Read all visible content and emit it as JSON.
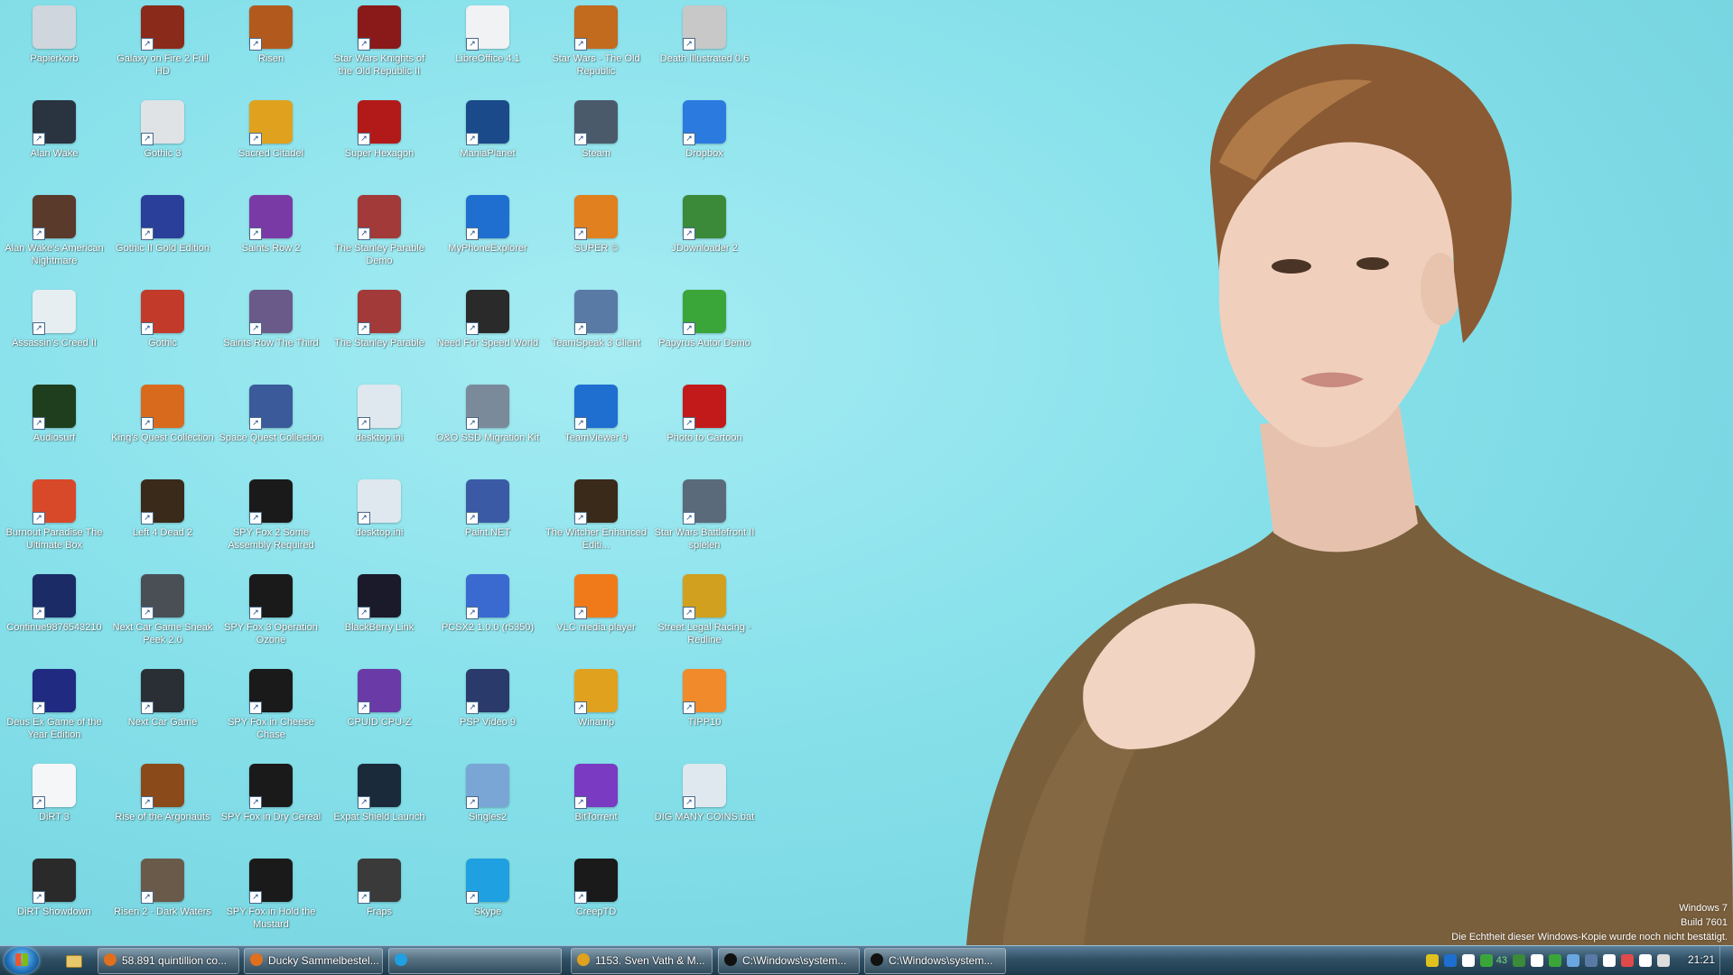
{
  "desktop": {
    "columns": [
      [
        {
          "label": "Papierkorb",
          "icon": "recycle-bin-icon",
          "color": "#cfd6dd"
        },
        {
          "label": "Alan Wake",
          "icon": "game-icon",
          "color": "#2a3340"
        },
        {
          "label": "Alan Wake's American Nightmare",
          "icon": "game-icon",
          "color": "#5a3a2a"
        },
        {
          "label": "Assassin's Creed II",
          "icon": "game-icon",
          "color": "#e6eef2"
        },
        {
          "label": "Audiosurf",
          "icon": "game-icon",
          "color": "#1e3e1e"
        },
        {
          "label": "Burnout Paradise The Ultimate Box",
          "icon": "game-icon",
          "color": "#d8492a"
        },
        {
          "label": "Continue9876543210",
          "icon": "game-icon",
          "color": "#1b2b66"
        },
        {
          "label": "Deus Ex Game of the Year Edition",
          "icon": "game-icon",
          "color": "#1f2a80"
        },
        {
          "label": "DiRT 3",
          "icon": "file-icon",
          "color": "#f4f6f8"
        },
        {
          "label": "DiRT Showdown",
          "icon": "game-icon",
          "color": "#2a2a2a"
        }
      ],
      [
        {
          "label": "Galaxy on Fire 2 Full HD",
          "icon": "game-icon",
          "color": "#8a2a1a"
        },
        {
          "label": "Gothic 3",
          "icon": "game-icon",
          "color": "#dfe3e6"
        },
        {
          "label": "Gothic II Gold Edition",
          "icon": "game-icon",
          "color": "#2a3f9a"
        },
        {
          "label": "Gothic",
          "icon": "game-icon",
          "color": "#c23a2a"
        },
        {
          "label": "King's Quest Collection",
          "icon": "game-icon",
          "color": "#d86a1e"
        },
        {
          "label": "Left 4 Dead 2",
          "icon": "game-icon",
          "color": "#3a2a1a"
        },
        {
          "label": "Next Car Game Sneak Peek 2.0",
          "icon": "game-icon",
          "color": "#4a4f56"
        },
        {
          "label": "Next Car Game",
          "icon": "game-icon",
          "color": "#2a2f36"
        },
        {
          "label": "Rise of the Argonauts",
          "icon": "game-icon",
          "color": "#8a4a1a"
        },
        {
          "label": "Risen 2 - Dark Waters",
          "icon": "game-icon",
          "color": "#6a5a4a"
        }
      ],
      [
        {
          "label": "Risen",
          "icon": "game-icon",
          "color": "#b25a1e"
        },
        {
          "label": "Sacred Citadel",
          "icon": "game-icon",
          "color": "#e0a21e"
        },
        {
          "label": "Saints Row 2",
          "icon": "game-icon",
          "color": "#7a3aa6"
        },
        {
          "label": "Saints Row The Third",
          "icon": "game-icon",
          "color": "#6a5a8a"
        },
        {
          "label": "Space Quest Collection",
          "icon": "game-icon",
          "color": "#3a5a9a"
        },
        {
          "label": "SPY Fox 2 Some Assembly Required",
          "icon": "game-icon",
          "color": "#1a1a1a"
        },
        {
          "label": "SPY Fox 3 Operation Ozone",
          "icon": "game-icon",
          "color": "#1a1a1a"
        },
        {
          "label": "SPY Fox in Cheese Chase",
          "icon": "game-icon",
          "color": "#1a1a1a"
        },
        {
          "label": "SPY Fox in Dry Cereal",
          "icon": "game-icon",
          "color": "#1a1a1a"
        },
        {
          "label": "SPY Fox in Hold the Mustard",
          "icon": "game-icon",
          "color": "#1a1a1a"
        }
      ],
      [
        {
          "label": "Star Wars Knights of the Old Republic II",
          "icon": "game-icon",
          "color": "#8a1a1a"
        },
        {
          "label": "Super Hexagon",
          "icon": "game-icon",
          "color": "#b21a1a"
        },
        {
          "label": "The Stanley Parable Demo",
          "icon": "game-icon",
          "color": "#a23a3a"
        },
        {
          "label": "The Stanley Parable",
          "icon": "game-icon",
          "color": "#a23a3a"
        },
        {
          "label": "desktop.ini",
          "icon": "settings-file-icon",
          "color": "#dfe8ee"
        },
        {
          "label": "desktop.ini",
          "icon": "settings-file-icon",
          "color": "#dfe8ee"
        },
        {
          "label": "BlackBerry Link",
          "icon": "blackberry-icon",
          "color": "#1a1a2a"
        },
        {
          "label": "CPUID CPU-Z",
          "icon": "cpu-icon",
          "color": "#6a3aa6"
        },
        {
          "label": "Expat Shield Launch",
          "icon": "shield-icon",
          "color": "#1a2a3a"
        },
        {
          "label": "Fraps",
          "icon": "fraps-icon",
          "color": "#3a3a3a"
        }
      ],
      [
        {
          "label": "LibreOffice 4.1",
          "icon": "file-icon",
          "color": "#f0f2f4"
        },
        {
          "label": "ManiaPlanet",
          "icon": "game-icon",
          "color": "#1a4a8a"
        },
        {
          "label": "MyPhoneExplorer",
          "icon": "sync-icon",
          "color": "#1f6fd0"
        },
        {
          "label": "Need For Speed World",
          "icon": "game-icon",
          "color": "#2a2a2a"
        },
        {
          "label": "O&O SSD Migration Kit",
          "icon": "tool-icon",
          "color": "#7a8a9a"
        },
        {
          "label": "Paint.NET",
          "icon": "paint-icon",
          "color": "#3a5aa6"
        },
        {
          "label": "PCSX2 1.0.0 (r5350)",
          "icon": "emulator-icon",
          "color": "#3a6ad0"
        },
        {
          "label": "PSP Video 9",
          "icon": "video-icon",
          "color": "#2a3a6a"
        },
        {
          "label": "Singles2",
          "icon": "game-icon",
          "color": "#7aa6d6"
        },
        {
          "label": "Skype",
          "icon": "skype-icon",
          "color": "#1fa0e0"
        }
      ],
      [
        {
          "label": "Star Wars - The Old Republic",
          "icon": "game-icon",
          "color": "#c26a1e"
        },
        {
          "label": "Steam",
          "icon": "steam-icon",
          "color": "#4a5a6a"
        },
        {
          "label": "SUPER ©",
          "icon": "media-converter-icon",
          "color": "#e0801e"
        },
        {
          "label": "TeamSpeak 3 Client",
          "icon": "teamspeak-icon",
          "color": "#5a7aa6"
        },
        {
          "label": "TeamViewer 9",
          "icon": "teamviewer-icon",
          "color": "#1e6fd0"
        },
        {
          "label": "The Witcher Enhanced Editi...",
          "icon": "game-icon",
          "color": "#3a2a1a"
        },
        {
          "label": "VLC media player",
          "icon": "vlc-icon",
          "color": "#f07a1a"
        },
        {
          "label": "Winamp",
          "icon": "winamp-icon",
          "color": "#e0a21e"
        },
        {
          "label": "BitTorrent",
          "icon": "bittorrent-icon",
          "color": "#7a3ac2"
        },
        {
          "label": "CreepTD",
          "icon": "game-icon",
          "color": "#1a1a1a"
        }
      ],
      [
        {
          "label": "Death Illustrated 0.6",
          "icon": "game-icon",
          "color": "#c8c8c8"
        },
        {
          "label": "Dropbox",
          "icon": "dropbox-icon",
          "color": "#2a7ae0"
        },
        {
          "label": "JDownloader 2",
          "icon": "download-icon",
          "color": "#3a8a3a"
        },
        {
          "label": "Papyrus Autor Demo",
          "icon": "papyrus-icon",
          "color": "#3aa63a"
        },
        {
          "label": "Photo to Cartoon",
          "icon": "pen-icon",
          "color": "#c21a1a"
        },
        {
          "label": "Star Wars Battlefront II spielen",
          "icon": "game-icon",
          "color": "#5a6a7a"
        },
        {
          "label": "Street Legal Racing - Redline",
          "icon": "game-icon",
          "color": "#d0a01e"
        },
        {
          "label": "TIPP10",
          "icon": "tipp10-icon",
          "color": "#f08a2a"
        },
        {
          "label": "DIG MANY COINS.bat",
          "icon": "batch-file-icon",
          "color": "#dfe8ee"
        },
        {
          "label": "",
          "icon": "",
          "color": ""
        }
      ]
    ]
  },
  "watermark": {
    "line1": "Windows 7",
    "line2": "Build 7601",
    "line3": "Die Echtheit dieser Windows-Kopie wurde noch nicht bestätigt."
  },
  "taskbar": {
    "items": [
      {
        "label": "58.891 quintillion co...",
        "icon": "firefox-icon",
        "color": "#e0701e"
      },
      {
        "label": "Ducky Sammelbestel...",
        "icon": "firefox-icon",
        "color": "#e0701e"
      },
      {
        "label": "",
        "icon": "skype-icon",
        "color": "#1fa0e0"
      },
      {
        "label": "1153. Sven Vath & M...",
        "icon": "winamp-icon",
        "color": "#e0a21e"
      },
      {
        "label": "C:\\Windows\\system...",
        "icon": "cmd-icon",
        "color": "#111111"
      },
      {
        "label": "C:\\Windows\\system...",
        "icon": "cmd-icon",
        "color": "#111111"
      }
    ],
    "tray_text": "43",
    "clock": "21:21"
  }
}
